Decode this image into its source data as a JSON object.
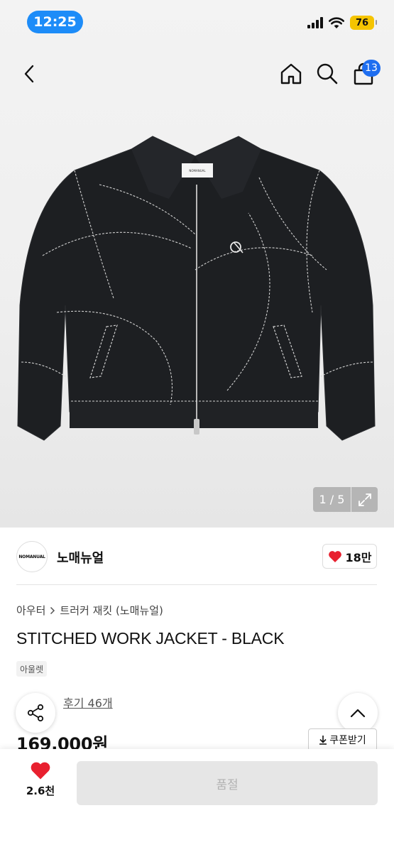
{
  "status_bar": {
    "time": "12:25",
    "battery": "76"
  },
  "header": {
    "back_icon": "chevron-left-icon",
    "home_icon": "home-icon",
    "search_icon": "search-icon",
    "cart_icon": "shopping-bag-icon",
    "cart_count": "13"
  },
  "gallery": {
    "pager": "1 / 5",
    "expand_icon": "expand-icon",
    "jacket_label_text": "NOMANUAL"
  },
  "brand": {
    "logo_text": "NOMANUAL",
    "name": "노매뉴얼",
    "likes": "18만"
  },
  "product": {
    "breadcrumb": [
      "아우터",
      "트러커 재킷 (노매뉴얼)"
    ],
    "title": "STITCHED WORK JACKET - BLACK",
    "tag": "아울렛",
    "review_text": "후기 46개",
    "price": "169,000원",
    "coupon_label": "쿠폰받기"
  },
  "bottom": {
    "wish_count": "2.6천",
    "soldout_label": "품절"
  },
  "colors": {
    "accent_blue": "#1e6ef0",
    "heart_red": "#e8202f",
    "battery_yellow": "#f5c400"
  }
}
